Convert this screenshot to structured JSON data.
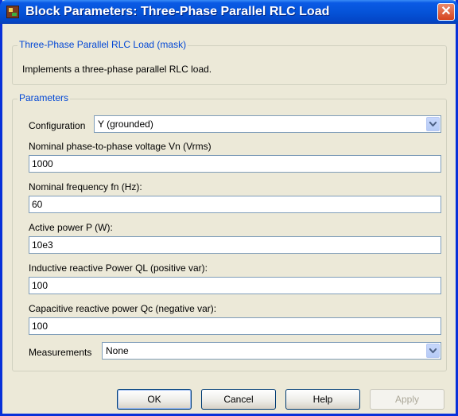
{
  "window": {
    "title": "Block Parameters: Three-Phase Parallel RLC Load"
  },
  "mask": {
    "legend": "Three-Phase Parallel RLC Load (mask)",
    "description": "Implements a three-phase parallel RLC load."
  },
  "params": {
    "legend": "Parameters",
    "configuration": {
      "label": "Configuration",
      "value": "Y (grounded)"
    },
    "voltage": {
      "label": "Nominal phase-to-phase voltage Vn (Vrms)",
      "value": "1000"
    },
    "frequency": {
      "label": "Nominal frequency fn (Hz):",
      "value": "60"
    },
    "active_power": {
      "label": "Active power P (W):",
      "value": "10e3"
    },
    "inductive": {
      "label": "Inductive reactive Power QL (positive var):",
      "value": "100"
    },
    "capacitive": {
      "label": "Capacitive reactive power Qc (negative var):",
      "value": "100"
    },
    "measurements": {
      "label": "Measurements",
      "value": "None"
    }
  },
  "buttons": {
    "ok": "OK",
    "cancel": "Cancel",
    "help": "Help",
    "apply": "Apply"
  }
}
